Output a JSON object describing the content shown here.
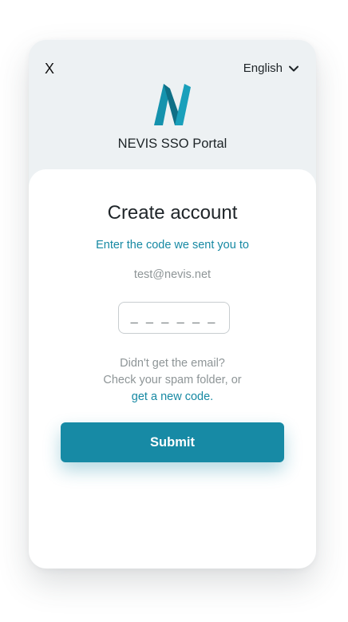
{
  "header": {
    "close_label": "X",
    "language": "English",
    "portal_title": "NEVIS SSO Portal"
  },
  "form": {
    "title": "Create account",
    "subtitle": "Enter the code we sent you to",
    "email": "test@nevis.net",
    "code_placeholder": "_ _ _ _ _ _",
    "code_value": "",
    "help_line1": "Didn't get the email?",
    "help_line2": "Check your spam folder, or",
    "new_code_link": "get a new code.",
    "submit_label": "Submit"
  },
  "colors": {
    "accent": "#178aa5",
    "header_bg": "#edf1f3",
    "text_dark": "#1f2529",
    "text_muted": "#8e9597"
  },
  "icons": {
    "logo": "nevis-logo",
    "language_chevron": "chevron-down-icon"
  }
}
